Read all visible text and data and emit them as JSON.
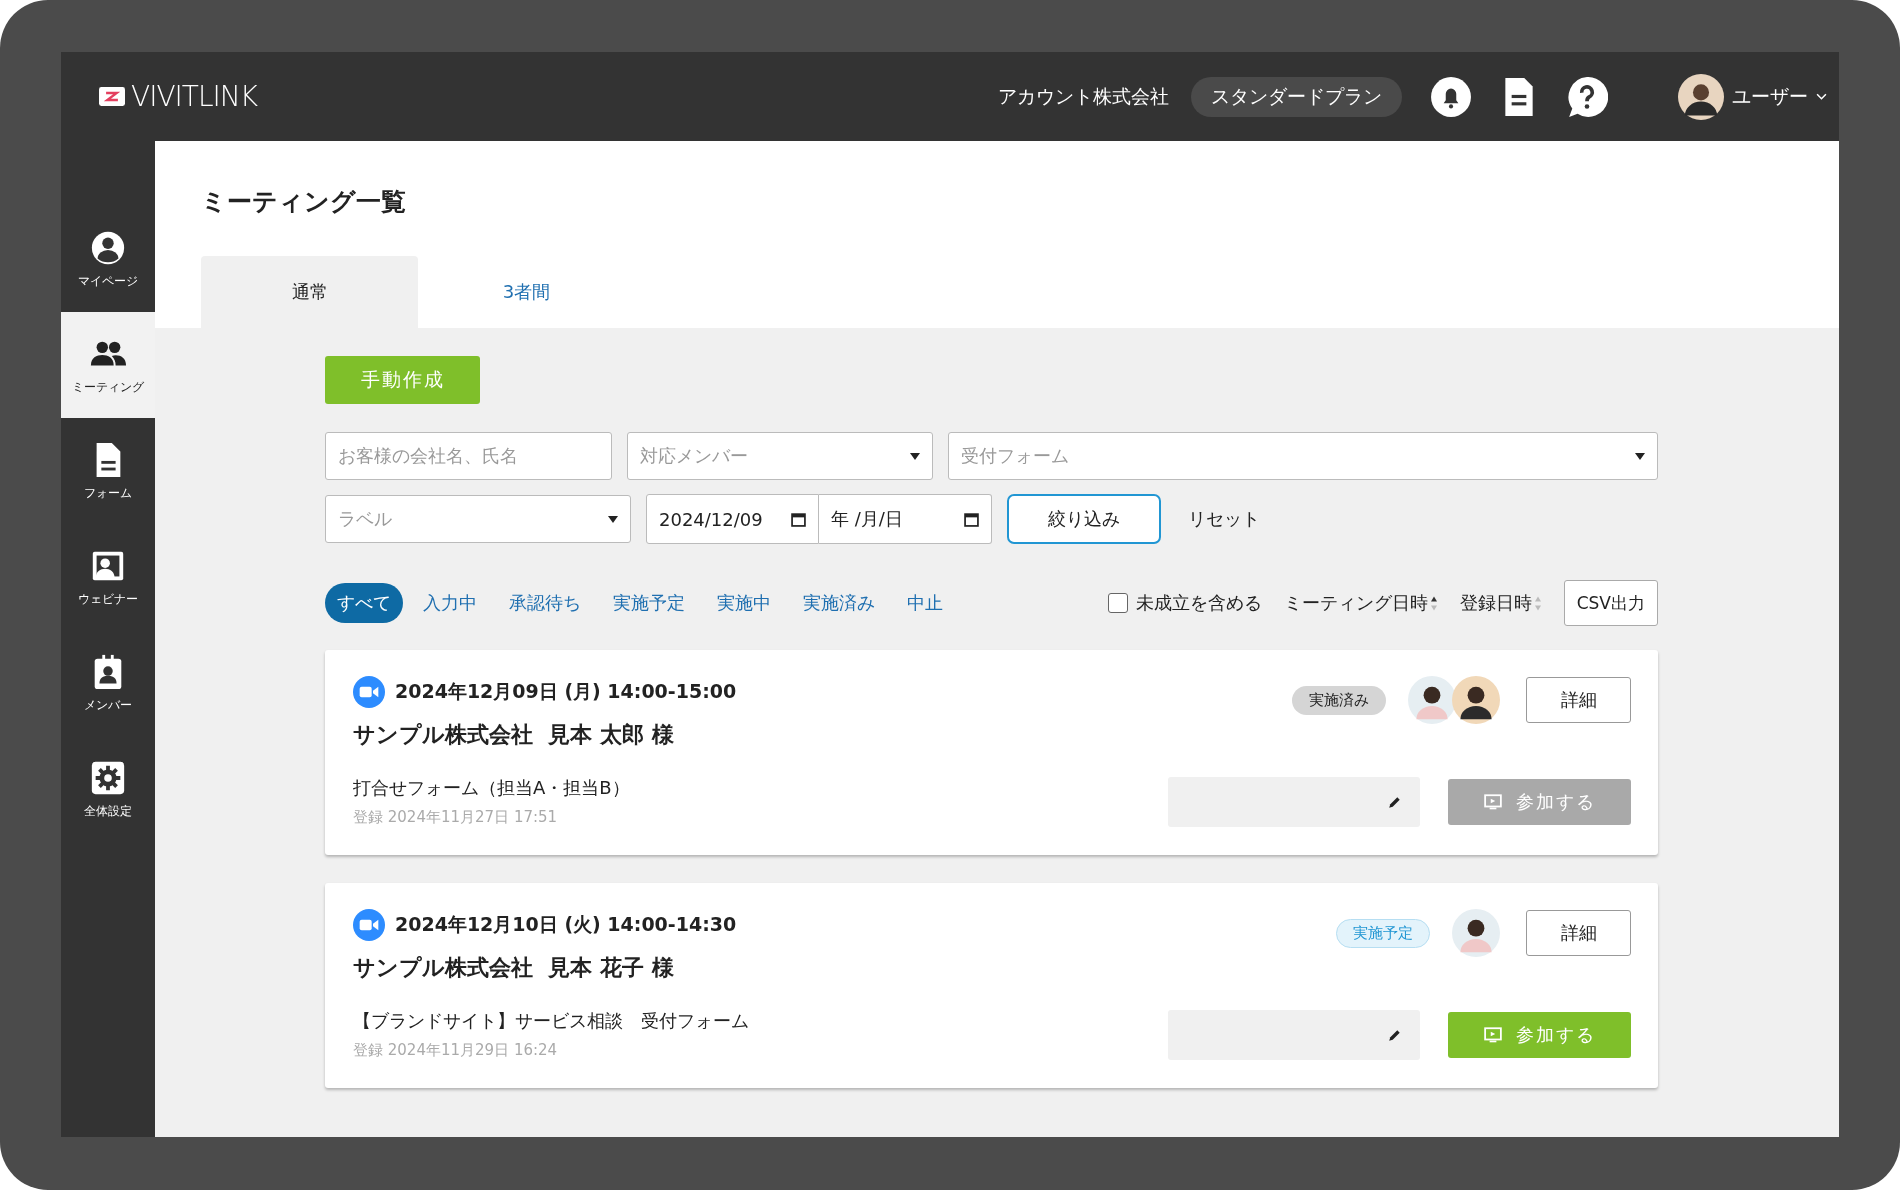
{
  "header": {
    "logo": "VIVITLINK",
    "account": "アカウント株式会社",
    "plan": "スタンダードプラン",
    "user": "ユーザー"
  },
  "sidebar": {
    "items": [
      {
        "label": "マイページ",
        "kind": "person",
        "selected": false
      },
      {
        "label": "ミーティング",
        "kind": "people",
        "selected": true
      },
      {
        "label": "フォーム",
        "kind": "doc",
        "selected": false
      },
      {
        "label": "ウェビナー",
        "kind": "webinar",
        "selected": false
      },
      {
        "label": "メンバー",
        "kind": "badge",
        "selected": false
      },
      {
        "label": "全体設定",
        "kind": "gear",
        "selected": false
      }
    ]
  },
  "page": {
    "title": "ミーティング一覧"
  },
  "tabs": [
    {
      "label": "通常",
      "selected": true
    },
    {
      "label": "3者間",
      "selected": false
    }
  ],
  "create_button": "手動作成",
  "filters": {
    "customer": {
      "placeholder": "お客様の会社名、氏名"
    },
    "member": {
      "placeholder": "対応メンバー"
    },
    "form": {
      "placeholder": "受付フォーム"
    },
    "label": {
      "placeholder": "ラベル"
    },
    "date_from": {
      "value": "2024/12/09"
    },
    "date_to": {
      "placeholder": "年 /月/日"
    },
    "apply": "絞り込み",
    "reset": "リセット"
  },
  "status_filters": [
    {
      "label": "すべて",
      "selected": true
    },
    {
      "label": "入力中",
      "selected": false
    },
    {
      "label": "承認待ち",
      "selected": false
    },
    {
      "label": "実施予定",
      "selected": false
    },
    {
      "label": "実施中",
      "selected": false
    },
    {
      "label": "実施済み",
      "selected": false
    },
    {
      "label": "中止",
      "selected": false
    }
  ],
  "include_unconfirmed": {
    "label": "未成立を含める",
    "checked": false
  },
  "sorts": [
    {
      "label": "ミーティング日時",
      "sorted": true
    },
    {
      "label": "登録日時",
      "sorted": false
    }
  ],
  "csv_button": "CSV出力",
  "meetings": [
    {
      "datetime": "2024年12月09日 (月) 14:00-15:00",
      "customer": "サンプル株式会社  見本 太郎 様",
      "form": "打合せフォーム（担当A・担当B）",
      "registered": "登録 2024年11月27日 17:51",
      "status": {
        "label": "実施済み",
        "kind": "done"
      },
      "detail": "詳細",
      "join": {
        "label": "参加する",
        "disabled": true
      }
    },
    {
      "datetime": "2024年12月10日 (火) 14:00-14:30",
      "customer": "サンプル株式会社  見本 花子 様",
      "form": "【ブランドサイト】サービス相談　受付フォーム",
      "registered": "登録 2024年11月29日 16:24",
      "status": {
        "label": "実施予定",
        "kind": "planned"
      },
      "detail": "詳細",
      "join": {
        "label": "参加する",
        "disabled": false
      }
    }
  ]
}
